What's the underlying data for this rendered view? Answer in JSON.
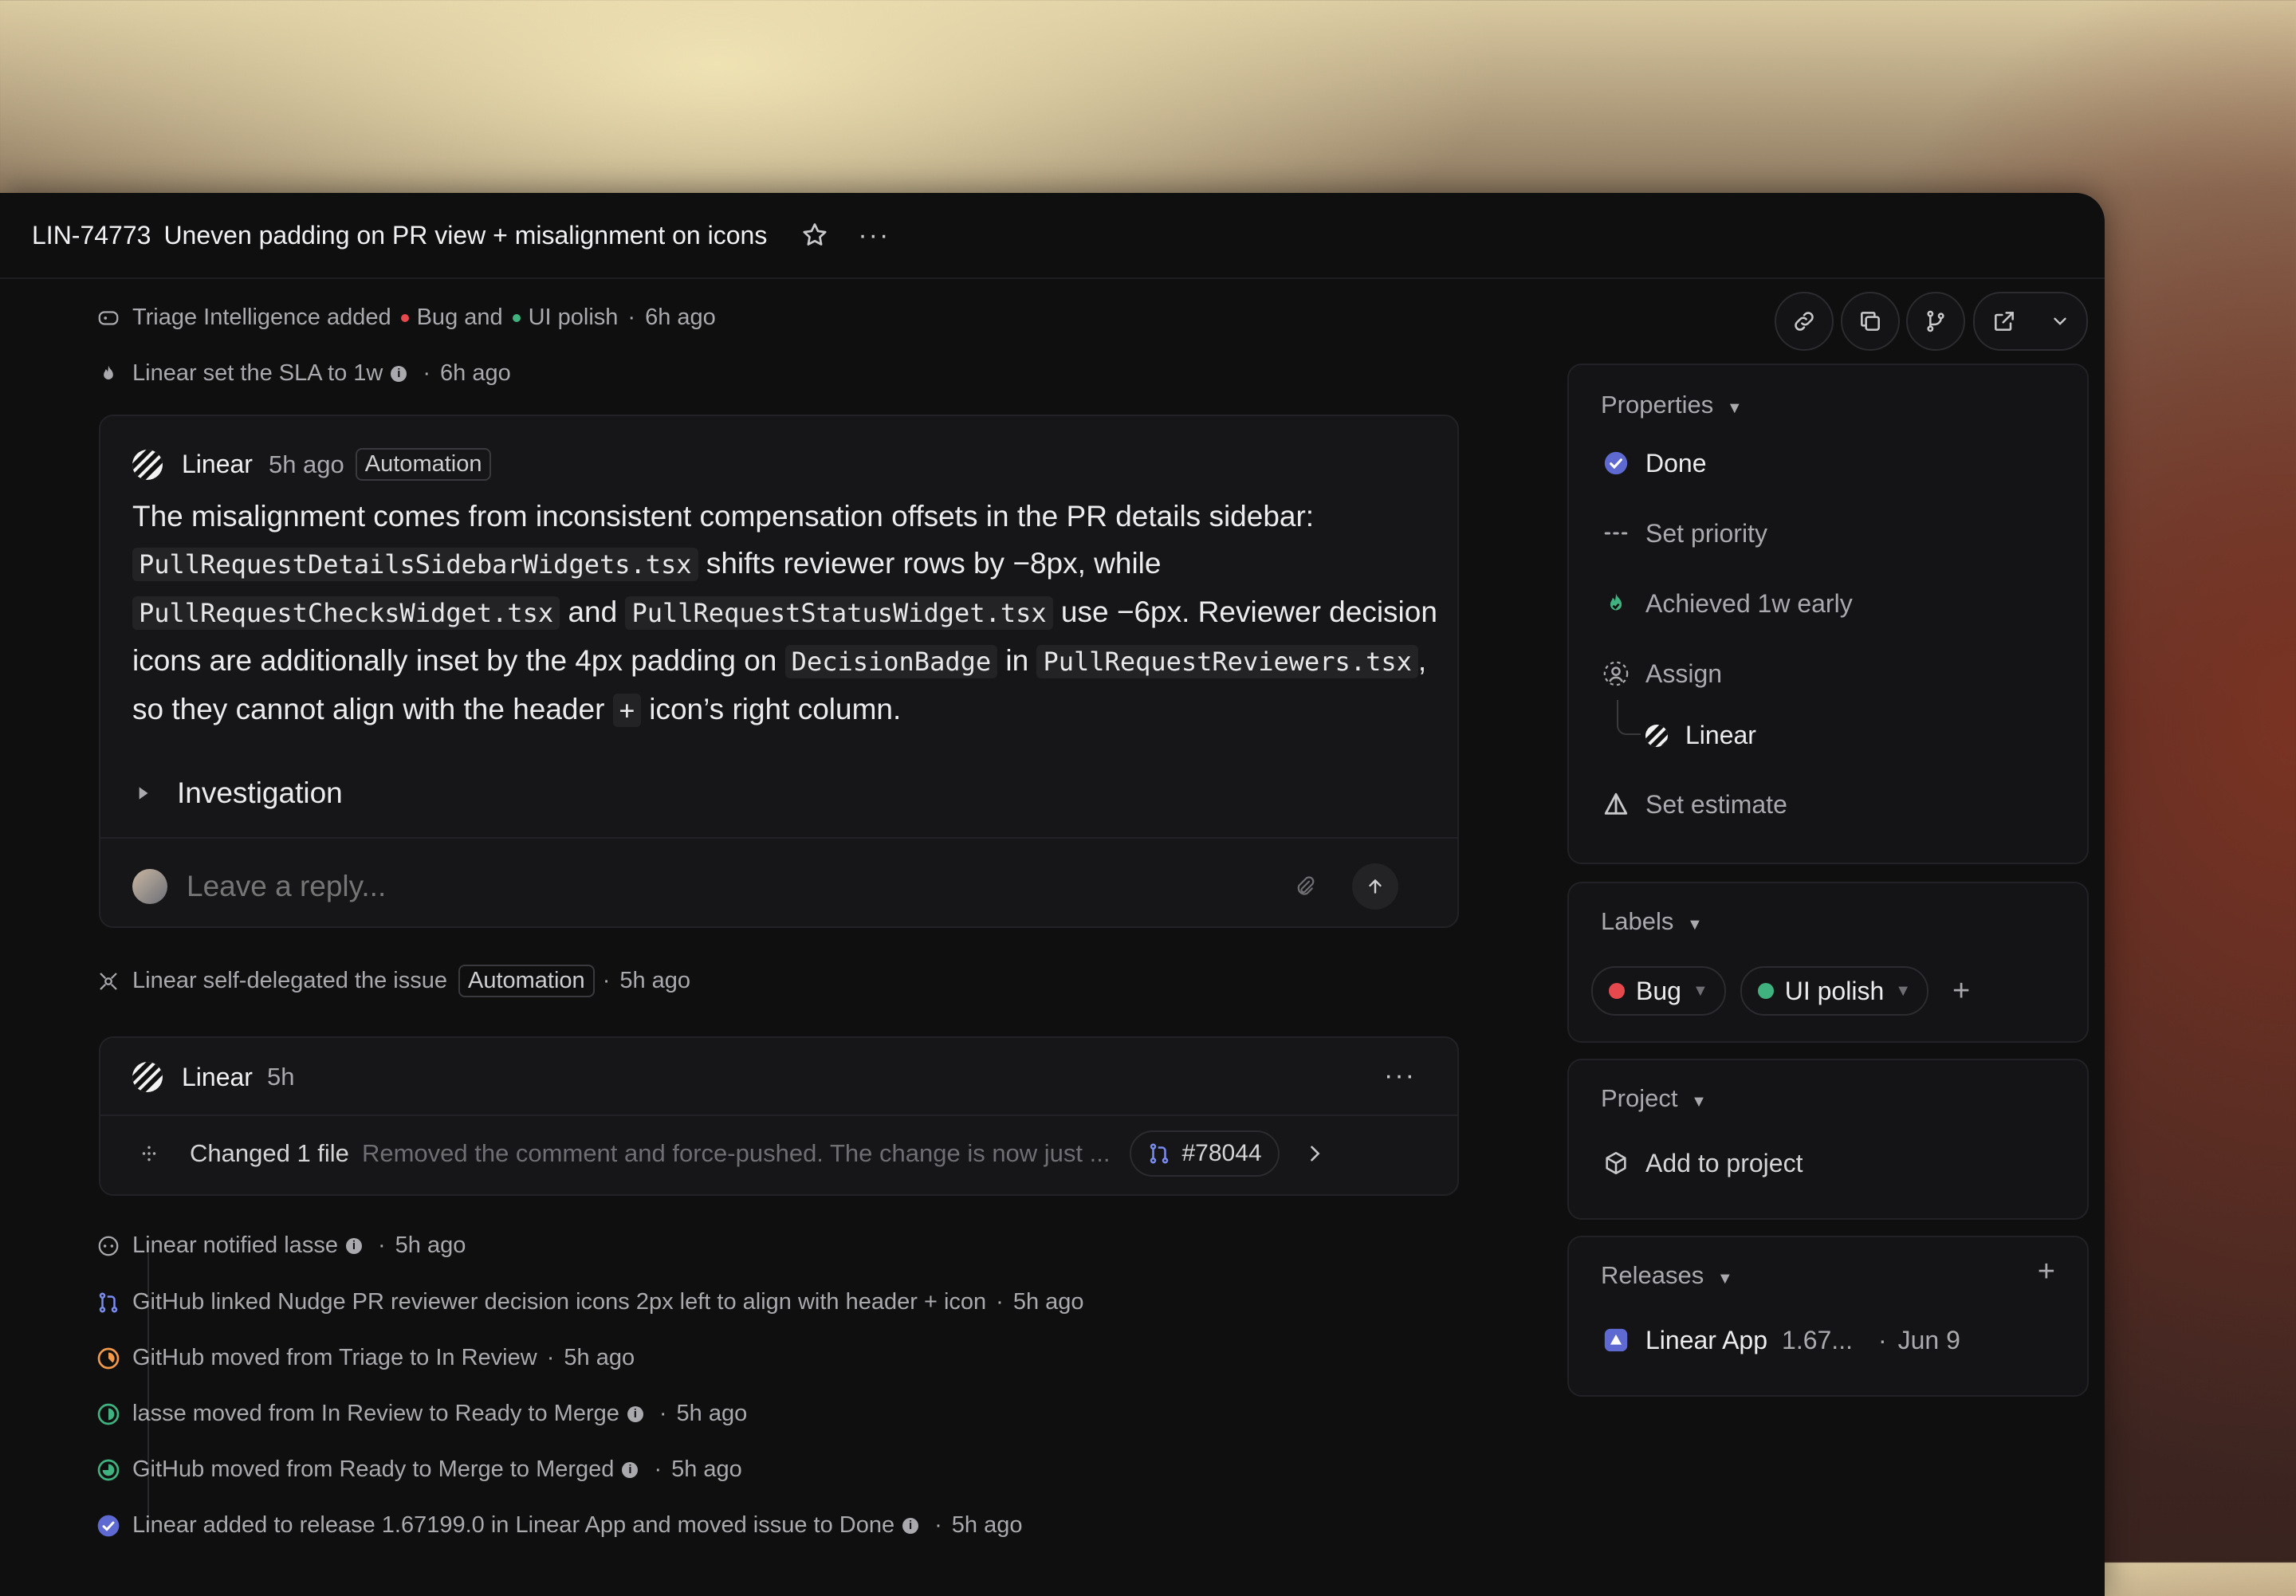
{
  "header": {
    "issue_id": "LIN-74773",
    "title": "Uneven padding on PR view + misalignment on icons"
  },
  "activity_top": [
    {
      "actor": "Triage Intelligence added",
      "label1": "Bug",
      "and": "and",
      "label2": "UI polish",
      "time": "6h ago"
    },
    {
      "text": "Linear set the SLA to 1w",
      "time": "6h ago"
    }
  ],
  "comment": {
    "author": "Linear",
    "time": "5h ago",
    "badge": "Automation",
    "p1": "The misalignment comes from inconsistent compensation offsets in the PR details sidebar:",
    "code1": "PullRequestDetailsSidebarWidgets.tsx",
    "p2": " shifts reviewer rows by −8px, while",
    "code2": "PullRequestChecksWidget.tsx",
    "p3": " and ",
    "code3": "PullRequestStatusWidget.tsx",
    "p4": " use −6px. Reviewer decision icons are additionally inset by the 4px padding on ",
    "code4": "DecisionBadge",
    "p5": " in",
    "code5": "PullRequestReviewers.tsx",
    "p6": ", so they cannot align with the header ",
    "code6": "+",
    "p7": " icon’s right column.",
    "investigation": "Investigation",
    "reply_placeholder": "Leave a reply..."
  },
  "delegation": {
    "text": "Linear self-delegated the issue",
    "badge": "Automation",
    "time": "5h ago"
  },
  "agent_card": {
    "author": "Linear",
    "time": "5h",
    "changed": "Changed 1 file",
    "summary": "Removed the comment and force-pushed. The change is now just ...",
    "pr": "#78044"
  },
  "activity_bottom": [
    {
      "text": "Linear notified lasse",
      "info": true,
      "time": "5h ago"
    },
    {
      "text": "GitHub linked Nudge PR reviewer decision icons 2px left to align with header + icon",
      "info": false,
      "time": "5h ago"
    },
    {
      "text": "GitHub moved from Triage to In Review",
      "info": false,
      "time": "5h ago"
    },
    {
      "text": "lasse moved from In Review to Ready to Merge",
      "info": true,
      "time": "5h ago"
    },
    {
      "text": "GitHub moved from Ready to Merge to Merged",
      "info": true,
      "time": "5h ago"
    },
    {
      "text": "Linear added to release 1.67199.0 in Linear App and moved issue to Done",
      "info": true,
      "time": "5h ago"
    }
  ],
  "sidebar": {
    "properties_title": "Properties",
    "status": "Done",
    "priority": "Set priority",
    "sla": "Achieved 1w early",
    "assign": "Assign",
    "assignee": "Linear",
    "estimate": "Set estimate",
    "labels_title": "Labels",
    "labels": [
      {
        "name": "Bug",
        "color": "#e5484d"
      },
      {
        "name": "UI polish",
        "color": "#3fb27f"
      }
    ],
    "project_title": "Project",
    "add_project": "Add to project",
    "releases_title": "Releases",
    "release_name": "Linear App",
    "release_version": "1.67...",
    "release_date": "Jun 9"
  },
  "colors": {
    "accent": "#5e6ad2",
    "done": "#5e6ad2",
    "bug": "#e5484d",
    "polish": "#3fb27f",
    "progress": "#f2994a"
  }
}
